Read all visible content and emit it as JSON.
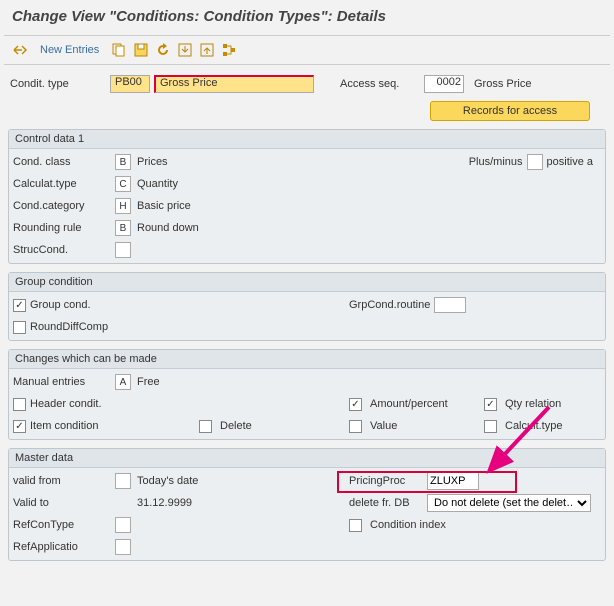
{
  "title": "Change View \"Conditions: Condition Types\": Details",
  "toolbar": {
    "new_entries": "New Entries"
  },
  "header": {
    "condit_type_label": "Condit. type",
    "condit_type_code": "PB00",
    "condit_type_desc": "Gross Price",
    "access_seq_label": "Access seq.",
    "access_seq_code": "0002",
    "access_seq_desc": "Gross Price",
    "records_btn": "Records for access"
  },
  "control_data": {
    "title": "Control data 1",
    "cond_class_label": "Cond. class",
    "cond_class_code": "B",
    "cond_class_desc": "Prices",
    "calc_type_label": "Calculat.type",
    "calc_type_code": "C",
    "calc_type_desc": "Quantity",
    "cond_cat_label": "Cond.category",
    "cond_cat_code": "H",
    "cond_cat_desc": "Basic price",
    "rounding_label": "Rounding rule",
    "rounding_code": "B",
    "rounding_desc": "Round down",
    "struc_label": "StrucCond.",
    "plus_minus_label": "Plus/minus",
    "plus_minus_desc": "positive a"
  },
  "group_cond": {
    "title": "Group condition",
    "group_cond_label": "Group cond.",
    "grp_routine_label": "GrpCond.routine",
    "round_diff_label": "RoundDiffComp"
  },
  "changes": {
    "title": "Changes which can be made",
    "manual_label": "Manual entries",
    "manual_code": "A",
    "manual_desc": "Free",
    "header_label": "Header condit.",
    "item_label": "Item condition",
    "delete_label": "Delete",
    "amount_label": "Amount/percent",
    "value_label": "Value",
    "qty_label": "Qty relation",
    "calc_label": "Calcult.type"
  },
  "master": {
    "title": "Master data",
    "valid_from_label": "valid from",
    "valid_from_val": "Today's date",
    "valid_to_label": "Valid to",
    "valid_to_val": "31.12.9999",
    "refcon_label": "RefConType",
    "refapp_label": "RefApplicatio",
    "pricing_proc_label": "PricingProc",
    "pricing_proc_val": "ZLUXP",
    "delete_db_label": "delete fr. DB",
    "delete_db_val": "Do not delete (set the delet…",
    "cond_index_label": "Condition index"
  }
}
